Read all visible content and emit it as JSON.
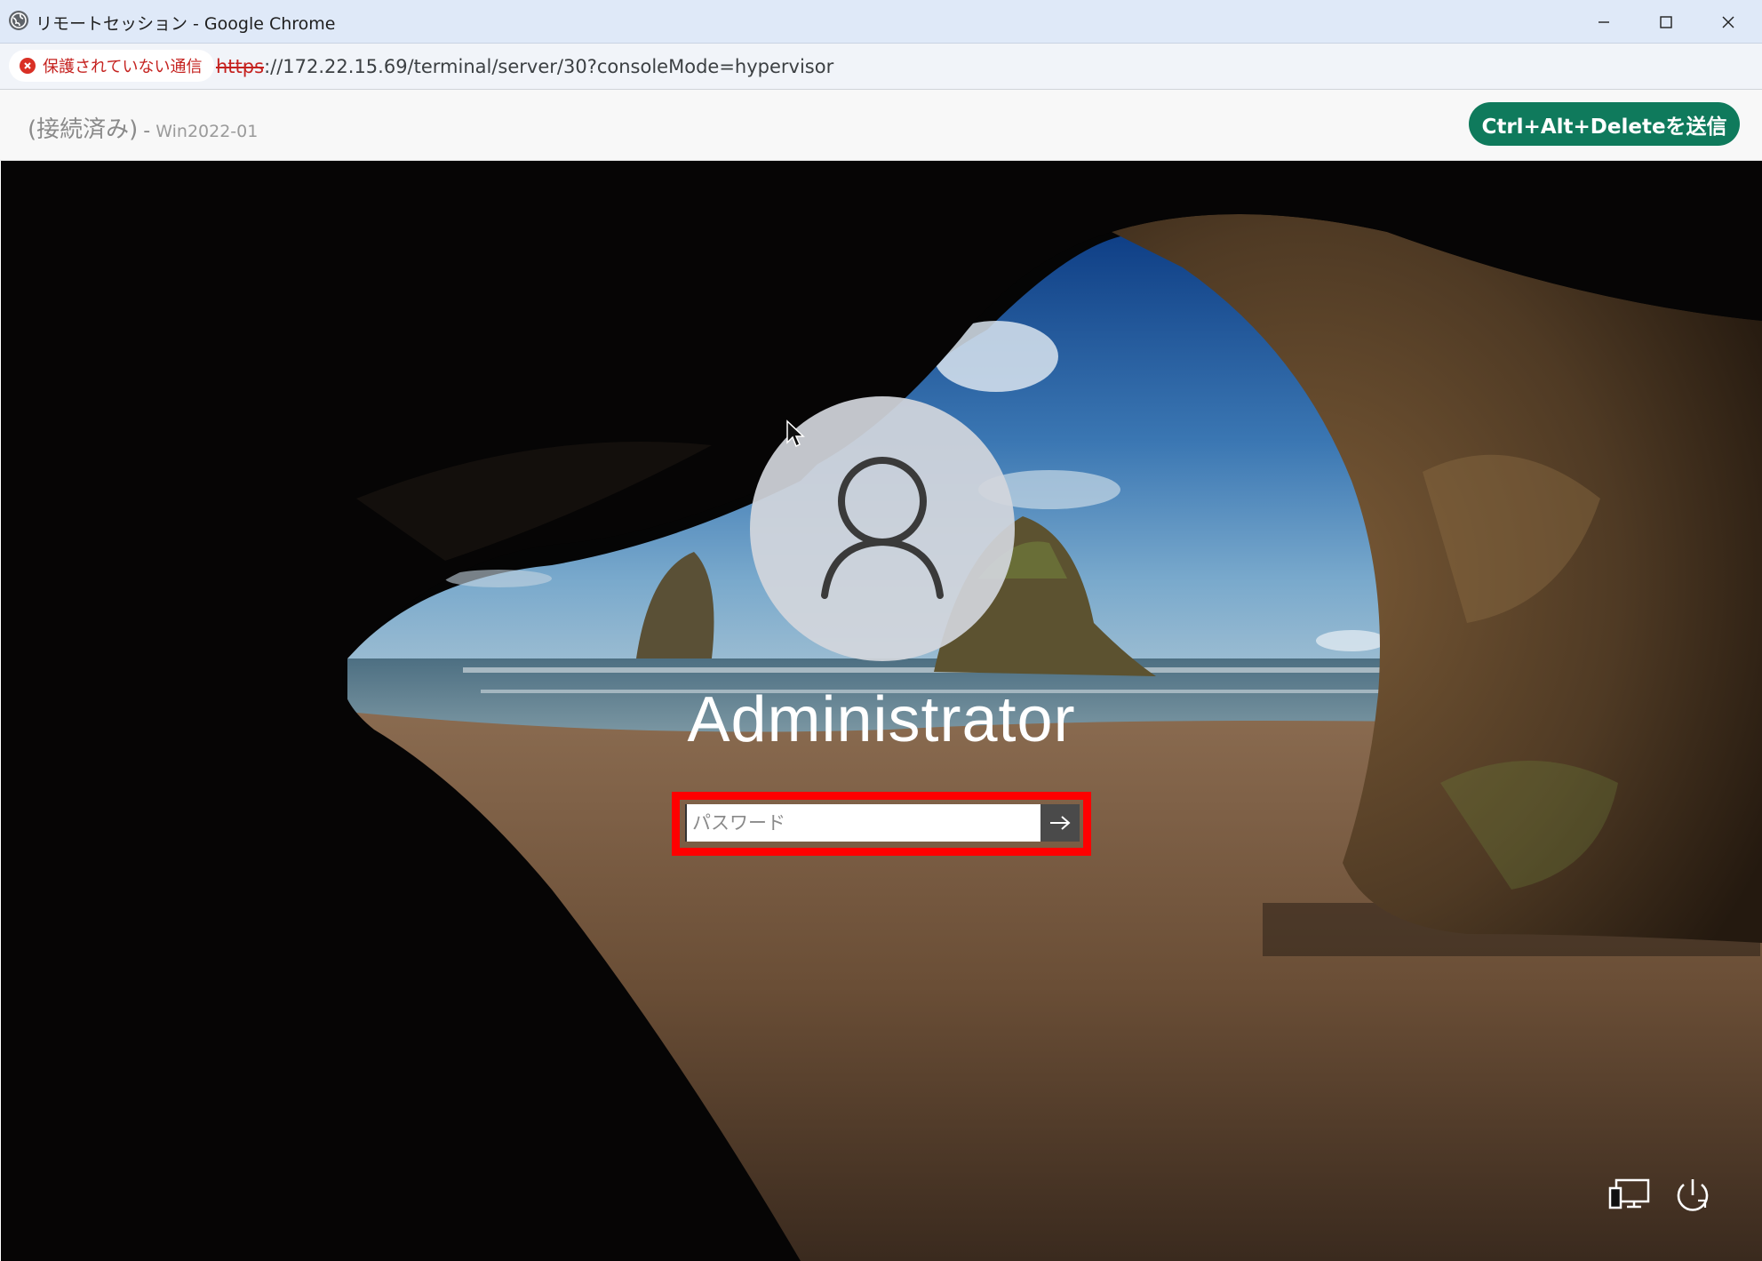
{
  "window": {
    "title": "リモートセッション - Google Chrome",
    "icon": "globe-icon"
  },
  "addressbar": {
    "security_label": "保護されていない通信",
    "url_scheme": "https",
    "url_rest": "://172.22.15.69/terminal/server/30?consoleMode=hypervisor"
  },
  "header": {
    "status": "(接続済み)",
    "separator": "-",
    "server_name": "Win2022-01",
    "cad_button": "Ctrl+Alt+Deleteを送信"
  },
  "login": {
    "username": "Administrator",
    "password_placeholder": "パスワード",
    "submit_icon": "arrow-right-icon"
  },
  "colors": {
    "accent_button": "#0f7a5c",
    "highlight": "#ff0000",
    "insecure": "#c5221f"
  }
}
